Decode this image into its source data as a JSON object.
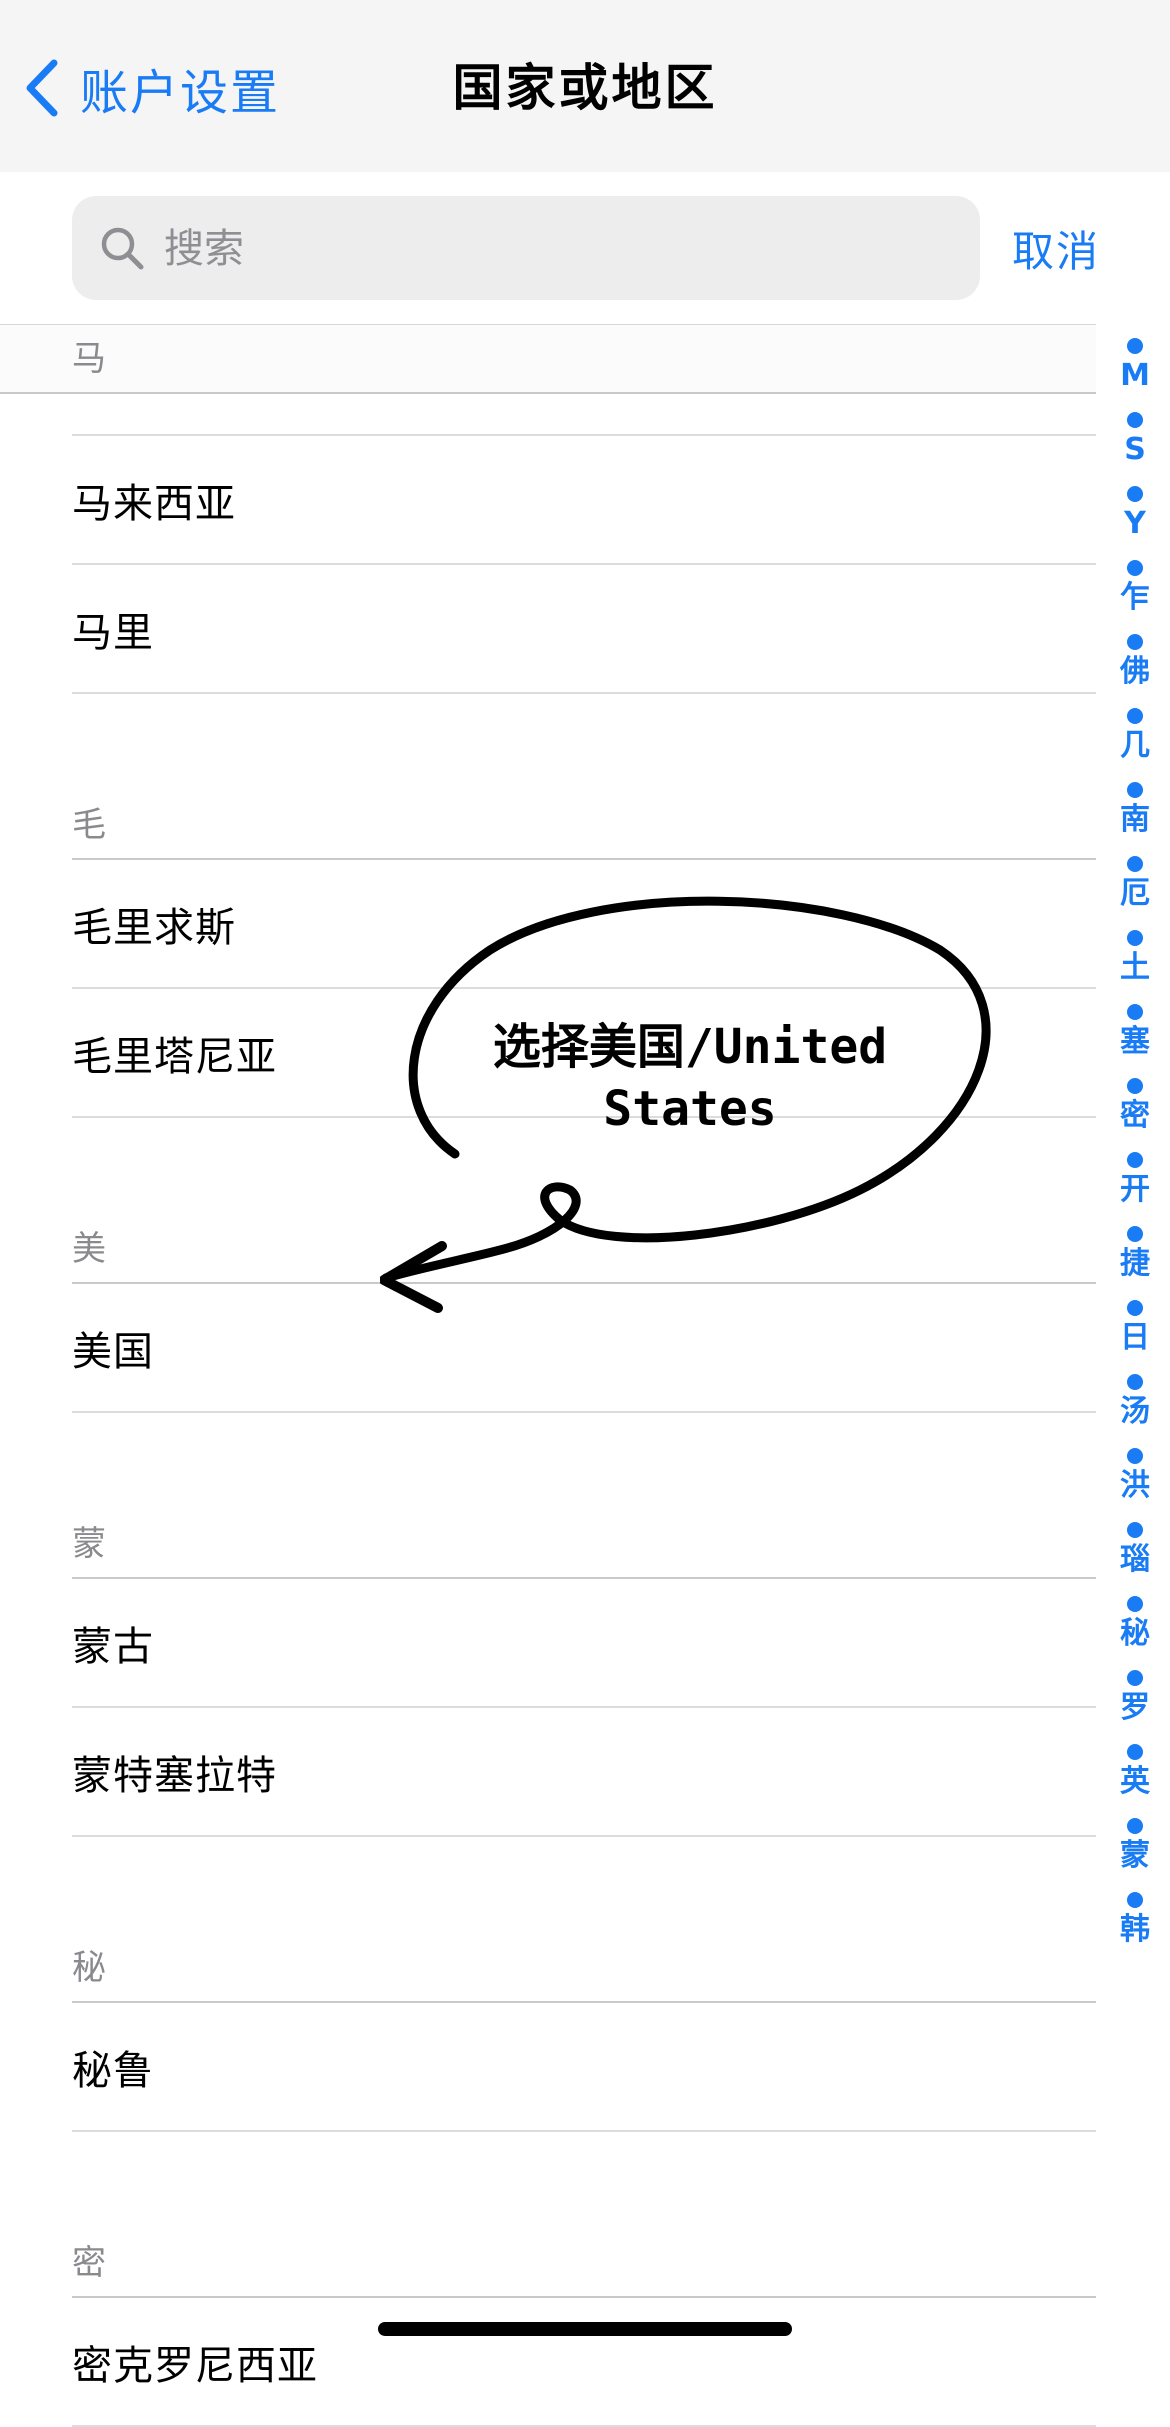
{
  "nav": {
    "back_label": "账户设置",
    "title": "国家或地区"
  },
  "search": {
    "placeholder": "搜索",
    "cancel_label": "取消"
  },
  "sections": [
    {
      "header": "马",
      "items": [
        "马来西亚",
        "马里"
      ]
    },
    {
      "header": "毛",
      "items": [
        "毛里求斯",
        "毛里塔尼亚"
      ]
    },
    {
      "header": "美",
      "items": [
        "美国"
      ]
    },
    {
      "header": "蒙",
      "items": [
        "蒙古",
        "蒙特塞拉特"
      ]
    },
    {
      "header": "秘",
      "items": [
        "秘鲁"
      ]
    },
    {
      "header": "密",
      "items": [
        "密克罗尼西亚"
      ]
    }
  ],
  "index": [
    "M",
    "S",
    "Y",
    "乍",
    "佛",
    "几",
    "南",
    "厄",
    "土",
    "塞",
    "密",
    "开",
    "捷",
    "日",
    "汤",
    "洪",
    "瑙",
    "秘",
    "罗",
    "英",
    "蒙",
    "韩"
  ],
  "annotation": {
    "line1": "选择美国/United",
    "line2": "States"
  },
  "colors": {
    "accent": "#1a7cf5",
    "nav_bg": "#f5f5f6",
    "search_bg": "#ededee",
    "header_text": "#8a8a8e"
  },
  "icons": {
    "back": "chevron-left-icon",
    "search": "search-icon",
    "index_dot": "dot-icon"
  }
}
